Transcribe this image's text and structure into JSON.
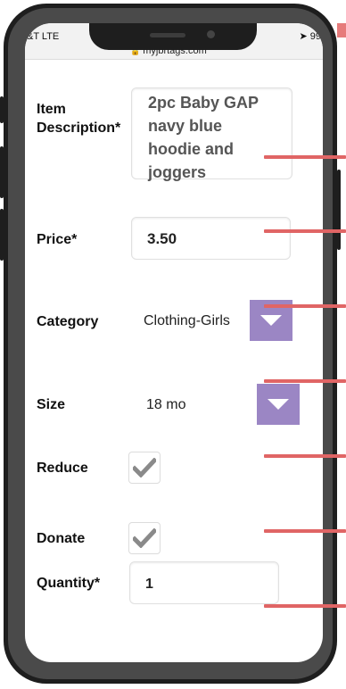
{
  "status": {
    "carrier": "&T  LTE",
    "battery": "99",
    "url": "myjbrtags.com"
  },
  "form": {
    "description": {
      "label_line1": "Item",
      "label_line2": "Description*",
      "value": "2pc Baby GAP navy blue hoodie and joggers"
    },
    "price": {
      "label": "Price*",
      "value": "3.50"
    },
    "category": {
      "label": "Category",
      "value": "Clothing-Girls"
    },
    "size": {
      "label": "Size",
      "value": "18 mo"
    },
    "reduce": {
      "label": "Reduce",
      "checked": true
    },
    "donate": {
      "label": "Donate",
      "checked": true
    },
    "quantity": {
      "label": "Quantity*",
      "value": "1"
    }
  },
  "colors": {
    "accent": "#9b86c4",
    "marker": "#e06565",
    "frame": "#1e1e1e"
  }
}
